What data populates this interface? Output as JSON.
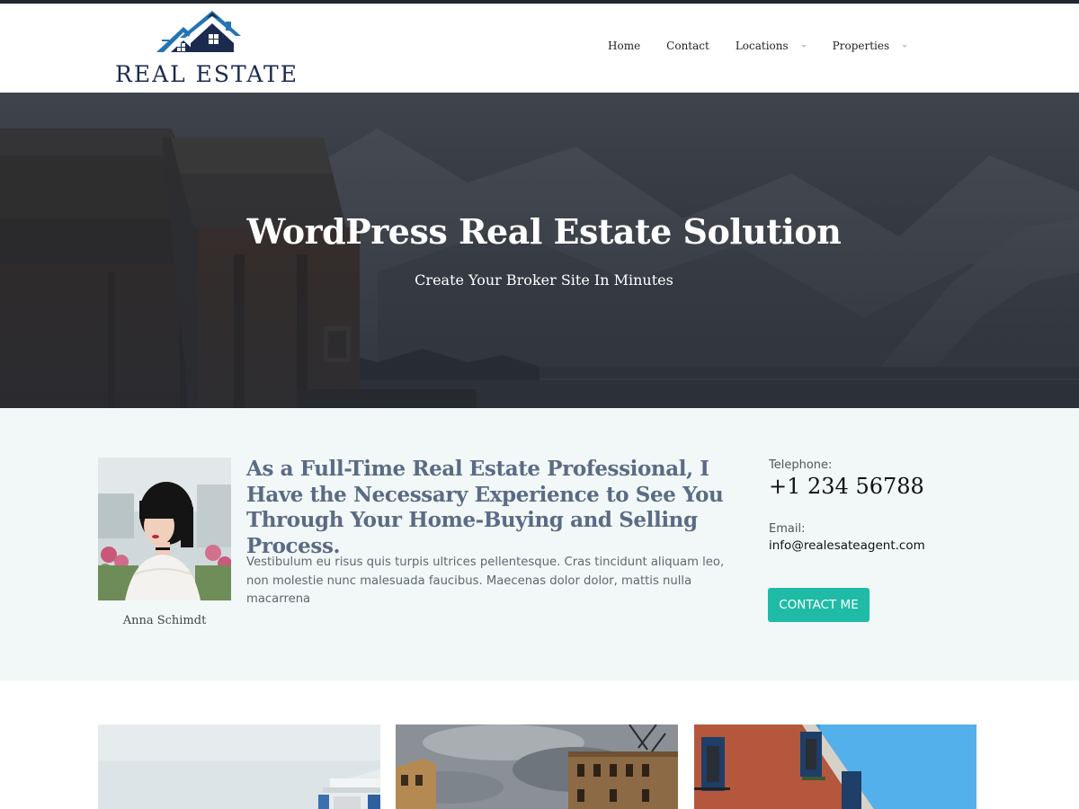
{
  "colors": {
    "accent": "#1fbba6",
    "logo_blue": "#2474b5",
    "logo_navy": "#1b2a4e",
    "heading": "#5b6b86",
    "section_bg": "#f1f8f7"
  },
  "header": {
    "logo": {
      "text": "REAL ESTATE",
      "icon": "house-roofs-logo-icon"
    },
    "nav": [
      {
        "label": "Home",
        "dropdown": false
      },
      {
        "label": "Contact",
        "dropdown": false
      },
      {
        "label": "Locations",
        "dropdown": true
      },
      {
        "label": "Properties",
        "dropdown": true
      }
    ]
  },
  "hero": {
    "title": "WordPress Real Estate Solution",
    "subtitle": "Create Your Broker Site In Minutes"
  },
  "agent": {
    "name": "Anna Schimdt",
    "heading": "As a Full-Time Real Estate Professional, I Have the Necessary Experience to See You Through Your Home-Buying and Selling Process.",
    "bio": "Vestibulum eu risus quis turpis ultrices pellentesque. Cras tincidunt aliquam leo, non molestie nunc malesuada faucibus. Maecenas dolor dolor, mattis nulla macarrena",
    "telephone_label": "Telephone:",
    "telephone": "+1 234 56788",
    "email_label": "Email:",
    "email": "info@realesateagent.com",
    "contact_button": "CONTACT ME"
  }
}
